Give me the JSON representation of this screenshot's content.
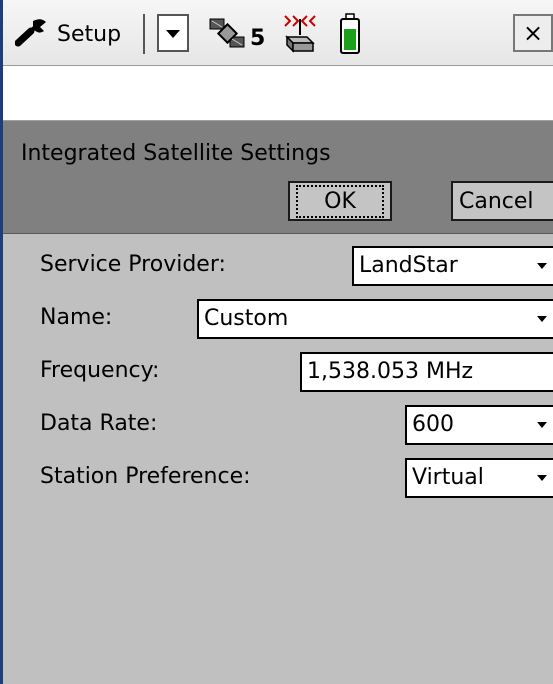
{
  "topbar": {
    "app_title": "Setup",
    "satellite_count": "5",
    "close_label": "×"
  },
  "header": {
    "title": "Integrated Satellite Settings",
    "ok_label": "OK",
    "cancel_label": "Cancel"
  },
  "form": {
    "service_provider": {
      "label": "Service Provider:",
      "value": "LandStar"
    },
    "name": {
      "label": "Name:",
      "value": "Custom"
    },
    "frequency": {
      "label": "Frequency:",
      "value": "1,538.053 MHz"
    },
    "data_rate": {
      "label": "Data Rate:",
      "value": "600"
    },
    "station_preference": {
      "label": "Station Preference:",
      "value": "Virtual"
    }
  },
  "colors": {
    "background": "#c0c0c0",
    "header_panel": "#808080",
    "battery_fill": "#1aa01a"
  },
  "icons": [
    "wrench-icon",
    "chevron-down-icon",
    "satellite-icon",
    "radio-icon",
    "battery-icon",
    "close-icon"
  ]
}
